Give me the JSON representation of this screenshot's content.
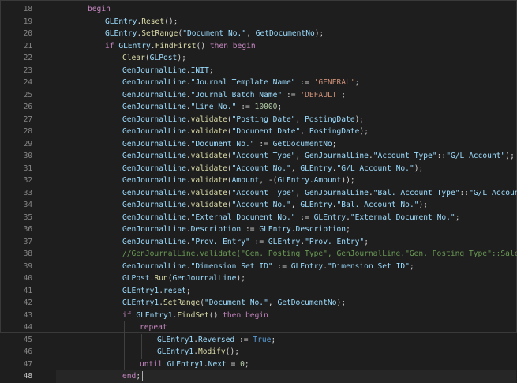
{
  "editor": {
    "first_line": 18,
    "lines": [
      {
        "n": "18",
        "indent": 0,
        "text": "begin"
      },
      {
        "n": "19",
        "indent": 1,
        "text": "GLEntry.Reset();"
      },
      {
        "n": "20",
        "indent": 1,
        "text": "GLEntry.SetRange(\"Document No.\", GetDocumentNo);"
      },
      {
        "n": "21",
        "indent": 1,
        "text": "if GLEntry.FindFirst() then begin"
      },
      {
        "n": "22",
        "indent": 2,
        "text": "Clear(GLPost);"
      },
      {
        "n": "23",
        "indent": 2,
        "text": "GenJournalLine.INIT;"
      },
      {
        "n": "24",
        "indent": 2,
        "text": "GenJournalLine.\"Journal Template Name\" := 'GENERAL';"
      },
      {
        "n": "25",
        "indent": 2,
        "text": "GenJournalLine.\"Journal Batch Name\" := 'DEFAULT';"
      },
      {
        "n": "26",
        "indent": 2,
        "text": "GenJournalLine.\"Line No.\" := 10000;"
      },
      {
        "n": "27",
        "indent": 2,
        "text": "GenJournalLine.validate(\"Posting Date\", PostingDate);"
      },
      {
        "n": "28",
        "indent": 2,
        "text": "GenJournalLine.validate(\"Document Date\", PostingDate);"
      },
      {
        "n": "29",
        "indent": 2,
        "text": "GenJournalLine.\"Document No.\" := GetDocumentNo;"
      },
      {
        "n": "30",
        "indent": 2,
        "text": "GenJournalLine.validate(\"Account Type\", GenJournalLine.\"Account Type\"::\"G/L Account\");"
      },
      {
        "n": "31",
        "indent": 2,
        "text": "GenJournalLine.validate(\"Account No.\", GLEntry.\"G/L Account No.\");"
      },
      {
        "n": "32",
        "indent": 2,
        "text": "GenJournalLine.validate(Amount, -(GLEntry.Amount));"
      },
      {
        "n": "33",
        "indent": 2,
        "text": "GenJournalLine.validate(\"Account Type\", GenJournalLine.\"Bal. Account Type\"::\"G/L Account\");"
      },
      {
        "n": "34",
        "indent": 2,
        "text": "GenJournalLine.validate(\"Account No.\", GLEntry.\"Bal. Account No.\");"
      },
      {
        "n": "35",
        "indent": 2,
        "text": "GenJournalLine.\"External Document No.\" := GLEntry.\"External Document No.\";"
      },
      {
        "n": "36",
        "indent": 2,
        "text": "GenJournalLine.Description := GLEntry.Description;"
      },
      {
        "n": "37",
        "indent": 2,
        "text": "GenJournalLine.\"Prov. Entry\" := GLEntry.\"Prov. Entry\";"
      },
      {
        "n": "38",
        "indent": 2,
        "text": "//GenJournalLine.validate(\"Gen. Posting Type\", GenJournalLine.\"Gen. Posting Type\"::Sale);"
      },
      {
        "n": "39",
        "indent": 2,
        "text": "GenJournalLine.\"Dimension Set ID\" := GLEntry.\"Dimension Set ID\";"
      },
      {
        "n": "40",
        "indent": 2,
        "text": "GLPost.Run(GenJournalLine);"
      },
      {
        "n": "41",
        "indent": 2,
        "text": "GLEntry1.reset;"
      },
      {
        "n": "42",
        "indent": 2,
        "text": "GLEntry1.SetRange(\"Document No.\", GetDocumentNo);"
      },
      {
        "n": "43",
        "indent": 2,
        "text": "if GLEntry1.FindSet() then begin"
      },
      {
        "n": "44",
        "indent": 3,
        "text": "repeat"
      },
      {
        "n": "45",
        "indent": 4,
        "text": "GLEntry1.Reversed := True;"
      },
      {
        "n": "46",
        "indent": 4,
        "text": "GLEntry1.Modify();"
      },
      {
        "n": "47",
        "indent": 3,
        "text": "until GLEntry1.Next = 0;"
      },
      {
        "n": "48",
        "indent": 2,
        "text": "end;",
        "active": true
      }
    ]
  },
  "colors": {
    "background": "#1e1e1e",
    "keyword": "#c586c0",
    "keyword_blue": "#569cd6",
    "identifier": "#9cdcfe",
    "function": "#dcdcaa",
    "string": "#ce9178",
    "number": "#b5cea8",
    "comment": "#6a9955"
  }
}
